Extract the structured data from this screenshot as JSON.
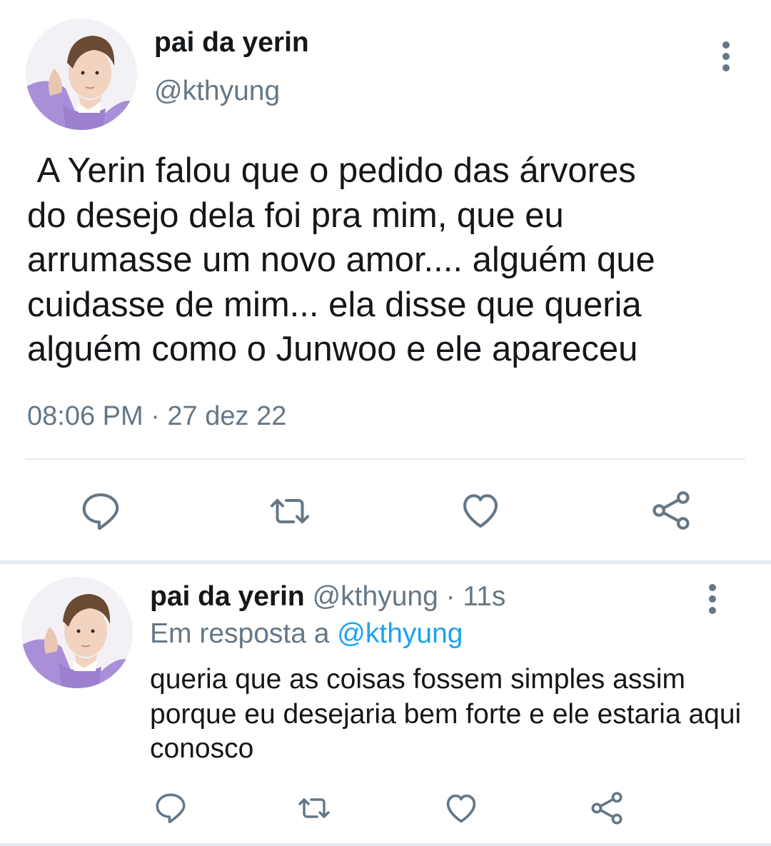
{
  "main_tweet": {
    "display_name": "pai da yerin",
    "handle": "@kthyung",
    "text": " A Yerin falou que o pedido das árvores\ndo desejo dela foi pra mim, que eu\narrumasse um novo amor.... alguém que\ncuidasse de mim... ela disse que queria\nalguém como o Junwoo e ele apareceu",
    "timestamp": "08:06 PM · 27 dez 22",
    "actions": [
      "reply-icon",
      "retweet-icon",
      "like-icon",
      "share-icon"
    ]
  },
  "reply_tweet": {
    "display_name": "pai da yerin",
    "meta": " @kthyung · 11s",
    "reply_prefix": "Em resposta a ",
    "reply_to_handle": "@kthyung",
    "text": "queria que as coisas fossem simples assim porque eu desejaria bem forte e ele estaria aqui conosco",
    "actions": [
      "reply-icon",
      "retweet-icon",
      "like-icon",
      "share-icon"
    ]
  },
  "colors": {
    "text_primary": "#14171a",
    "text_secondary": "#657786",
    "link": "#1da1f2",
    "divider": "#e6ecf0"
  }
}
